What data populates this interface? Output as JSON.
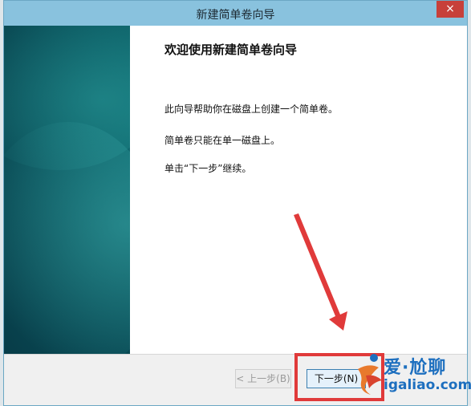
{
  "window": {
    "title": "新建简单卷向导",
    "close_symbol": "×"
  },
  "content": {
    "heading": "欢迎使用新建简单卷向导",
    "para1": "此向导帮助你在磁盘上创建一个简单卷。",
    "para2": "简单卷只能在单一磁盘上。",
    "para3": "单击“下一步”继续。"
  },
  "buttons": {
    "back_label": "< 上一步(B)",
    "next_label": "下一步(N)"
  },
  "watermark": {
    "line1": "爱·尬聊",
    "line2": "igaliao.com"
  },
  "colors": {
    "titlebar": "#89c2de",
    "highlight": "#e03a3a"
  }
}
